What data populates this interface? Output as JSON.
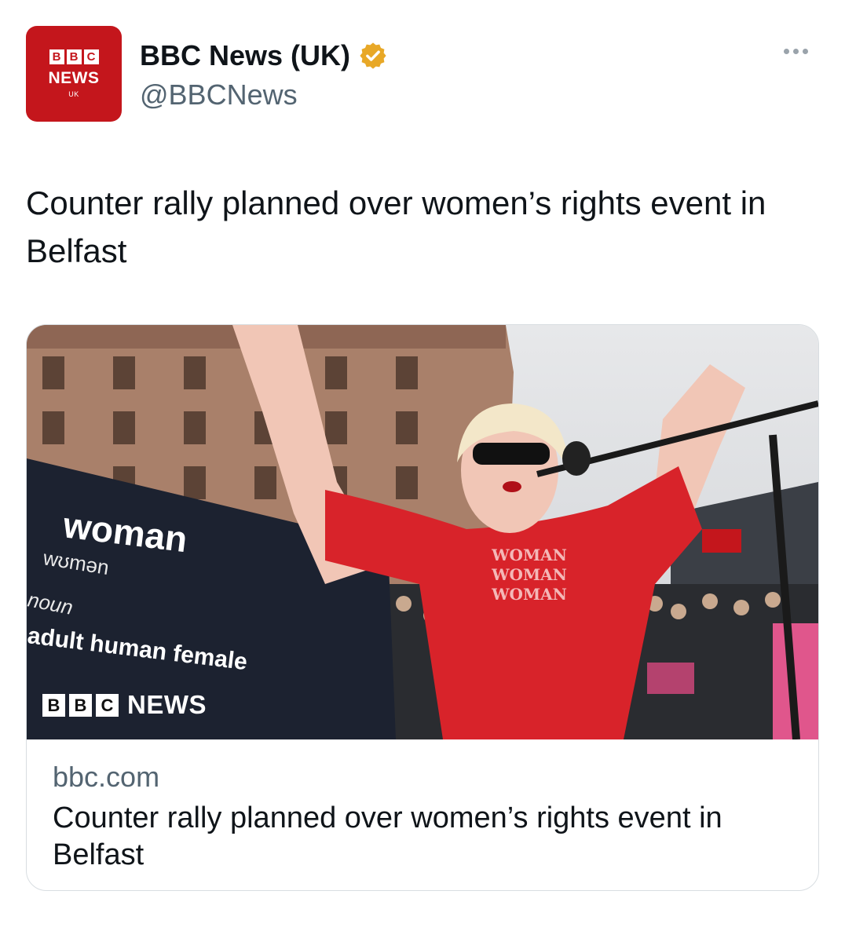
{
  "tweet": {
    "author": {
      "display_name": "BBC News (UK)",
      "handle": "@BBCNews",
      "verified": true,
      "verified_color": "#e8a827",
      "avatar": {
        "blocks": [
          "B",
          "B",
          "C"
        ],
        "label": "NEWS",
        "sublabel": "UK",
        "color": "#c4161c"
      }
    },
    "more_icon": "more-horizontal-icon",
    "text": "Counter rally planned over women’s rights event in Belfast"
  },
  "link_card": {
    "image": {
      "banner_lines": [
        "woman",
        "wʊmən",
        "noun",
        "adult human female"
      ],
      "shirt_lines": [
        "WOMAN",
        "WOMAN",
        "WOMAN"
      ],
      "watermark": {
        "blocks": [
          "B",
          "B",
          "C"
        ],
        "label": "NEWS"
      }
    },
    "domain": "bbc.com",
    "title": "Counter rally planned over women’s rights event in Belfast"
  }
}
